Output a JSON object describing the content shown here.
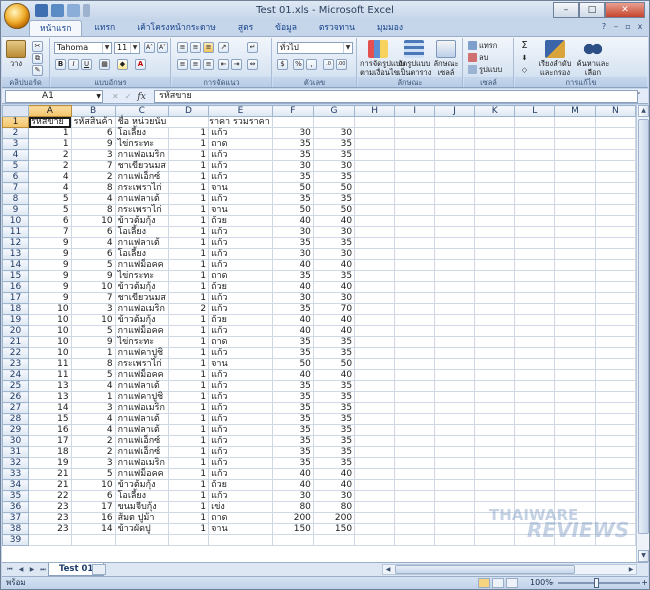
{
  "window": {
    "title": "Test 01.xls - Microsoft Excel",
    "minimize": "–",
    "maximize": "□",
    "close": "✕"
  },
  "ribbon": {
    "tabs": [
      "หน้าแรก",
      "แทรก",
      "เค้าโครงหน้ากระดาษ",
      "สูตร",
      "ข้อมูล",
      "ตรวจทาน",
      "มุมมอง"
    ],
    "active_tab": "หน้าแรก",
    "groups": {
      "clipboard": {
        "label": "คลิปบอร์ด",
        "paste": "วาง"
      },
      "font": {
        "label": "แบบอักษร",
        "font_name": "Tahoma",
        "font_size": "11",
        "bold": "B",
        "italic": "I",
        "underline": "U",
        "grow": "A˄",
        "shrink": "A˅",
        "font_color": "A"
      },
      "alignment": {
        "label": "การจัดแนว"
      },
      "number": {
        "label": "ตัวเลข",
        "format": "ทั่วไป",
        "percent": "%",
        "comma": ","
      },
      "styles": {
        "label": "ลักษณะ",
        "conditional": "การจัดรูปแบบ\nตามเงื่อนไข",
        "format_table": "จัดรูปแบบ\nเป็นตาราง",
        "cell_styles": "ลักษณะ\nเซลล์"
      },
      "cells": {
        "label": "เซลล์",
        "insert": "แทรก",
        "delete": "ลบ",
        "format": "รูปแบบ"
      },
      "editing": {
        "label": "การแก้ไข",
        "sigma": "Σ",
        "sort": "เรียงลำดับ\nและกรอง",
        "find": "ค้นหาและ\nเลือก"
      }
    }
  },
  "formula_bar": {
    "name_box": "A1",
    "fx": "fx",
    "content": "รหัสขาย"
  },
  "sheet": {
    "columns": [
      "A",
      "B",
      "C",
      "D",
      "E",
      "F",
      "G",
      "H",
      "I",
      "J",
      "K",
      "L",
      "M",
      "N"
    ],
    "selected_cell": "A1",
    "header": [
      "รหัสขาย",
      "รหัสสินค้า",
      "ชื่อ หน่วยนับ",
      "ราคา",
      "",
      "รวมราคา",
      ""
    ],
    "header_display": {
      "A": "รหัสขาย",
      "B": "รหัสสินค้า",
      "C": "ชื่อ หน่วยนับ",
      "D": "",
      "E": "",
      "F": "ราคา รวมราคา",
      "G": ""
    },
    "rows": [
      {
        "n": "2",
        "a": "1",
        "b": "6",
        "c": "โอเลี้ยง",
        "d": "1",
        "e": "แก้ว",
        "f": "30",
        "g": "30"
      },
      {
        "n": "3",
        "a": "1",
        "b": "9",
        "c": "ไข่กระทะ",
        "d": "1",
        "e": "ถาด",
        "f": "35",
        "g": "35"
      },
      {
        "n": "4",
        "a": "2",
        "b": "3",
        "c": "กาแฟอเมริก",
        "d": "1",
        "e": "แก้ว",
        "f": "35",
        "g": "35"
      },
      {
        "n": "5",
        "a": "2",
        "b": "7",
        "c": "ชาเขียวนมส",
        "d": "1",
        "e": "แก้ว",
        "f": "30",
        "g": "30"
      },
      {
        "n": "6",
        "a": "4",
        "b": "2",
        "c": "กาแฟเอ็กซ์",
        "d": "1",
        "e": "แก้ว",
        "f": "35",
        "g": "35"
      },
      {
        "n": "7",
        "a": "4",
        "b": "8",
        "c": "กระเพราไก่",
        "d": "1",
        "e": "จาน",
        "f": "50",
        "g": "50"
      },
      {
        "n": "8",
        "a": "5",
        "b": "4",
        "c": "กาแฟลาเต้",
        "d": "1",
        "e": "แก้ว",
        "f": "35",
        "g": "35"
      },
      {
        "n": "9",
        "a": "5",
        "b": "8",
        "c": "กระเพราไก่",
        "d": "1",
        "e": "จาน",
        "f": "50",
        "g": "50"
      },
      {
        "n": "10",
        "a": "6",
        "b": "10",
        "c": "ข้าวต้มกุ้ง",
        "d": "1",
        "e": "ถ้วย",
        "f": "40",
        "g": "40"
      },
      {
        "n": "11",
        "a": "7",
        "b": "6",
        "c": "โอเลี้ยง",
        "d": "1",
        "e": "แก้ว",
        "f": "30",
        "g": "30"
      },
      {
        "n": "12",
        "a": "9",
        "b": "4",
        "c": "กาแฟลาเต้",
        "d": "1",
        "e": "แก้ว",
        "f": "35",
        "g": "35"
      },
      {
        "n": "13",
        "a": "9",
        "b": "6",
        "c": "โอเลี้ยง",
        "d": "1",
        "e": "แก้ว",
        "f": "30",
        "g": "30"
      },
      {
        "n": "14",
        "a": "9",
        "b": "5",
        "c": "กาแฟม็อคค",
        "d": "1",
        "e": "แก้ว",
        "f": "40",
        "g": "40"
      },
      {
        "n": "15",
        "a": "9",
        "b": "9",
        "c": "ไข่กระทะ",
        "d": "1",
        "e": "ถาด",
        "f": "35",
        "g": "35"
      },
      {
        "n": "16",
        "a": "9",
        "b": "10",
        "c": "ข้าวต้มกุ้ง",
        "d": "1",
        "e": "ถ้วย",
        "f": "40",
        "g": "40"
      },
      {
        "n": "17",
        "a": "9",
        "b": "7",
        "c": "ชาเขียวนมส",
        "d": "1",
        "e": "แก้ว",
        "f": "30",
        "g": "30"
      },
      {
        "n": "18",
        "a": "10",
        "b": "3",
        "c": "กาแฟอเมริก",
        "d": "2",
        "e": "แก้ว",
        "f": "35",
        "g": "70"
      },
      {
        "n": "19",
        "a": "10",
        "b": "10",
        "c": "ข้าวต้มกุ้ง",
        "d": "1",
        "e": "ถ้วย",
        "f": "40",
        "g": "40"
      },
      {
        "n": "20",
        "a": "10",
        "b": "5",
        "c": "กาแฟม็อคค",
        "d": "1",
        "e": "แก้ว",
        "f": "40",
        "g": "40"
      },
      {
        "n": "21",
        "a": "10",
        "b": "9",
        "c": "ไข่กระทะ",
        "d": "1",
        "e": "ถาด",
        "f": "35",
        "g": "35"
      },
      {
        "n": "22",
        "a": "10",
        "b": "1",
        "c": "กาแฟคาปูชิ",
        "d": "1",
        "e": "แก้ว",
        "f": "35",
        "g": "35"
      },
      {
        "n": "23",
        "a": "11",
        "b": "8",
        "c": "กระเพราไก่",
        "d": "1",
        "e": "จาน",
        "f": "50",
        "g": "50"
      },
      {
        "n": "24",
        "a": "11",
        "b": "5",
        "c": "กาแฟม็อคค",
        "d": "1",
        "e": "แก้ว",
        "f": "40",
        "g": "40"
      },
      {
        "n": "25",
        "a": "13",
        "b": "4",
        "c": "กาแฟลาเต้",
        "d": "1",
        "e": "แก้ว",
        "f": "35",
        "g": "35"
      },
      {
        "n": "26",
        "a": "13",
        "b": "1",
        "c": "กาแฟคาปูชิ",
        "d": "1",
        "e": "แก้ว",
        "f": "35",
        "g": "35"
      },
      {
        "n": "27",
        "a": "14",
        "b": "3",
        "c": "กาแฟอเมริก",
        "d": "1",
        "e": "แก้ว",
        "f": "35",
        "g": "35"
      },
      {
        "n": "28",
        "a": "15",
        "b": "4",
        "c": "กาแฟลาเต้",
        "d": "1",
        "e": "แก้ว",
        "f": "35",
        "g": "35"
      },
      {
        "n": "29",
        "a": "16",
        "b": "4",
        "c": "กาแฟลาเต้",
        "d": "1",
        "e": "แก้ว",
        "f": "35",
        "g": "35"
      },
      {
        "n": "30",
        "a": "17",
        "b": "2",
        "c": "กาแฟเอ็กซ์",
        "d": "1",
        "e": "แก้ว",
        "f": "35",
        "g": "35"
      },
      {
        "n": "31",
        "a": "18",
        "b": "2",
        "c": "กาแฟเอ็กซ์",
        "d": "1",
        "e": "แก้ว",
        "f": "35",
        "g": "35"
      },
      {
        "n": "32",
        "a": "19",
        "b": "3",
        "c": "กาแฟอเมริก",
        "d": "1",
        "e": "แก้ว",
        "f": "35",
        "g": "35"
      },
      {
        "n": "33",
        "a": "21",
        "b": "5",
        "c": "กาแฟม็อคค",
        "d": "1",
        "e": "แก้ว",
        "f": "40",
        "g": "40"
      },
      {
        "n": "34",
        "a": "21",
        "b": "10",
        "c": "ข้าวต้มกุ้ง",
        "d": "1",
        "e": "ถ้วย",
        "f": "40",
        "g": "40"
      },
      {
        "n": "35",
        "a": "22",
        "b": "6",
        "c": "โอเลี้ยง",
        "d": "1",
        "e": "แก้ว",
        "f": "30",
        "g": "30"
      },
      {
        "n": "36",
        "a": "23",
        "b": "17",
        "c": "ขนมจีบกุ้ง",
        "d": "1",
        "e": "เข่ง",
        "f": "80",
        "g": "80"
      },
      {
        "n": "37",
        "a": "23",
        "b": "16",
        "c": "ส้มต ปูม้า",
        "d": "1",
        "e": "ถาด",
        "f": "200",
        "g": "200"
      },
      {
        "n": "38",
        "a": "23",
        "b": "14",
        "c": "ข้าวผัดปู",
        "d": "1",
        "e": "จาน",
        "f": "150",
        "g": "150"
      },
      {
        "n": "39",
        "a": "",
        "b": "",
        "c": "",
        "d": "",
        "e": "",
        "f": "",
        "g": ""
      }
    ]
  },
  "sheet_tabs": [
    "Test 01"
  ],
  "status": {
    "mode": "พร้อม",
    "zoom": "100%",
    "zoom_minus": "–",
    "zoom_plus": "+"
  },
  "watermark": {
    "line1": "THAIWARE",
    "line2": "REVIEWS"
  },
  "colors": {
    "ribbon_bg": "#d9e5f3",
    "accent": "#15428b",
    "selected_header": "#f2c467"
  }
}
